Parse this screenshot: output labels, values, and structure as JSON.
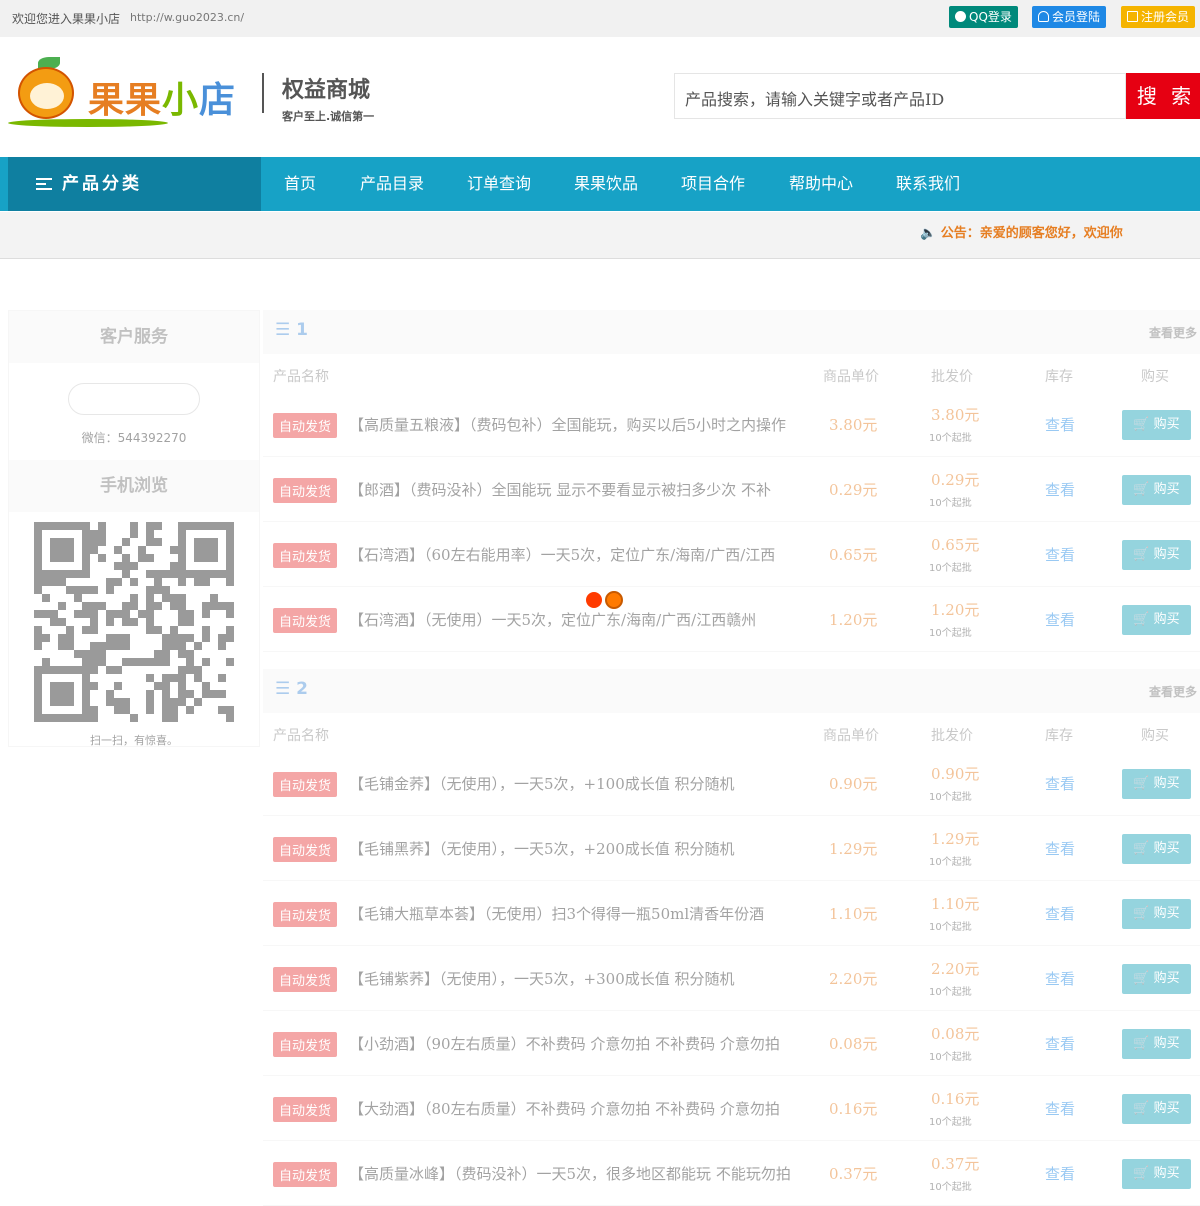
{
  "topbar": {
    "welcome": "欢迎您进入果果小店",
    "site_url": "http://w.guo2023.cn/",
    "qq_login": "QQ登录",
    "member_login": "会员登陆",
    "register": "注册会员",
    "colors": {
      "qq": "#00897b",
      "member": "#1e88e5",
      "register": "#f5b400"
    }
  },
  "logo": {
    "text_1": "果果",
    "text_2": "小",
    "text_3": "店"
  },
  "slogan": {
    "title": "权益商城",
    "subtitle": "客户至上.诚信第一"
  },
  "search": {
    "placeholder": "产品搜索，请输入关键字或者产品ID",
    "button": "搜 索"
  },
  "nav": {
    "category_label": "产品分类",
    "items": [
      "首页",
      "产品目录",
      "订单查询",
      "果果饮品",
      "项目合作",
      "帮助中心",
      "联系我们"
    ]
  },
  "notice": {
    "icon": "speaker-icon",
    "text": "公告：亲爱的顾客您好，欢迎你"
  },
  "sidebar": {
    "service_title": "客户服务",
    "wechat": "微信：544392270",
    "mobile_title": "手机浏览",
    "qr_caption": "扫一扫，有惊喜。"
  },
  "table_header": {
    "name": "产品名称",
    "price": "商品单价",
    "wholesale": "批发价",
    "stock": "库存",
    "buy": "购买"
  },
  "sections": [
    {
      "title": "1",
      "more": "查看更多",
      "rows": [
        {
          "tag": "自动发货",
          "name": "【高质量五粮液】（费码包补）全国能玩，购买以后5小时之内操作",
          "price": "3.80元",
          "wholesale": "3.80元",
          "min": "10个起批",
          "stock": "查看",
          "buy": "购买"
        },
        {
          "tag": "自动发货",
          "name": "【郎酒】（费码没补）全国能玩 显示不要看显示被扫多少次 不补",
          "price": "0.29元",
          "wholesale": "0.29元",
          "min": "10个起批",
          "stock": "查看",
          "buy": "购买"
        },
        {
          "tag": "自动发货",
          "name": "【石湾酒】（60左右能用率）一天5次，定位广东/海南/广西/江西",
          "price": "0.65元",
          "wholesale": "0.65元",
          "min": "10个起批",
          "stock": "查看",
          "buy": "购买"
        },
        {
          "tag": "自动发货",
          "name": "【石湾酒】（无使用）一天5次，定位广东/海南/广西/江西赣州",
          "price": "1.20元",
          "wholesale": "1.20元",
          "min": "10个起批",
          "stock": "查看",
          "buy": "购买"
        }
      ]
    },
    {
      "title": "2",
      "more": "查看更多",
      "rows": [
        {
          "tag": "自动发货",
          "name": "【毛铺金荞】（无使用），一天5次，+100成长值 积分随机",
          "price": "0.90元",
          "wholesale": "0.90元",
          "min": "10个起批",
          "stock": "查看",
          "buy": "购买"
        },
        {
          "tag": "自动发货",
          "name": "【毛铺黑荞】（无使用），一天5次，+200成长值 积分随机",
          "price": "1.29元",
          "wholesale": "1.29元",
          "min": "10个起批",
          "stock": "查看",
          "buy": "购买"
        },
        {
          "tag": "自动发货",
          "name": "【毛铺大瓶草本荟】（无使用）扫3个得得一瓶50ml清香年份酒",
          "price": "1.10元",
          "wholesale": "1.10元",
          "min": "10个起批",
          "stock": "查看",
          "buy": "购买"
        },
        {
          "tag": "自动发货",
          "name": "【毛铺紫荞】（无使用），一天5次，+300成长值 积分随机",
          "price": "2.20元",
          "wholesale": "2.20元",
          "min": "10个起批",
          "stock": "查看",
          "buy": "购买"
        },
        {
          "tag": "自动发货",
          "name": "【小劲酒】（90左右质量）不补费码 介意勿拍 不补费码 介意勿拍",
          "price": "0.08元",
          "wholesale": "0.08元",
          "min": "10个起批",
          "stock": "查看",
          "buy": "购买"
        },
        {
          "tag": "自动发货",
          "name": "【大劲酒】（80左右质量）不补费码 介意勿拍 不补费码 介意勿拍",
          "price": "0.16元",
          "wholesale": "0.16元",
          "min": "10个起批",
          "stock": "查看",
          "buy": "购买"
        },
        {
          "tag": "自动发货",
          "name": "【高质量冰峰】（费码没补）一天5次，很多地区都能玩 不能玩勿拍",
          "price": "0.37元",
          "wholesale": "0.37元",
          "min": "10个起批",
          "stock": "查看",
          "buy": "购买"
        }
      ]
    }
  ]
}
